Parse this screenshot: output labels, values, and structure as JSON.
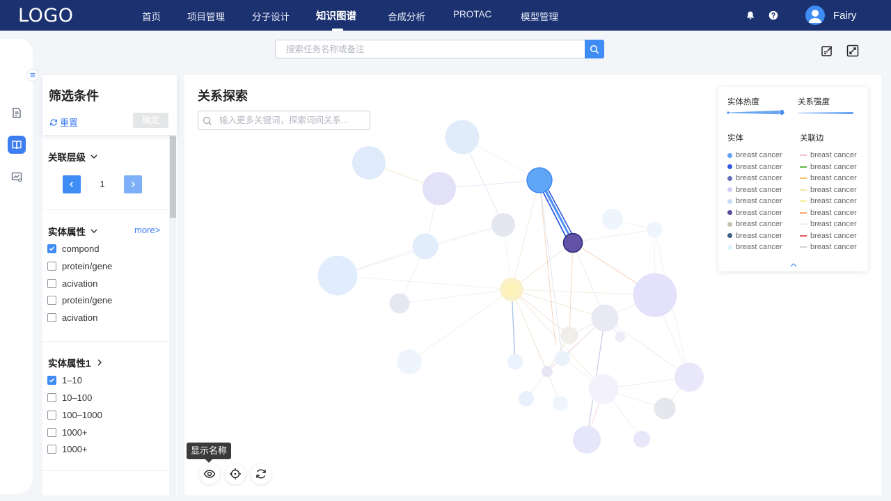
{
  "header": {
    "logo": "LOGO",
    "nav": [
      {
        "label": "首页",
        "active": false
      },
      {
        "label": "项目管理",
        "active": false
      },
      {
        "label": "分子设计",
        "active": false
      },
      {
        "label": "知识图谱",
        "active": true
      },
      {
        "label": "合成分析",
        "active": false
      },
      {
        "label": "PROTAC",
        "active": false
      },
      {
        "label": "模型管理",
        "active": false
      }
    ],
    "user_name": "Fairy"
  },
  "search": {
    "placeholder": "搜索任务名称或备注"
  },
  "filter": {
    "title": "筛选条件",
    "reset_label": "重置",
    "confirm_label": "确定",
    "level": {
      "title": "关联层级",
      "value": "1"
    },
    "entity_attr": {
      "title": "实体属性",
      "more_label": "more>",
      "options": [
        {
          "label": "compond",
          "checked": true
        },
        {
          "label": "protein/gene",
          "checked": false
        },
        {
          "label": "acivation",
          "checked": false
        },
        {
          "label": "protein/gene",
          "checked": false
        },
        {
          "label": "acivation",
          "checked": false
        }
      ]
    },
    "entity_attr1": {
      "title": "实体属性1",
      "options": [
        {
          "label": "1–10",
          "checked": true
        },
        {
          "label": "10–100",
          "checked": false
        },
        {
          "label": "100–1000",
          "checked": false
        },
        {
          "label": "1000+",
          "checked": false
        },
        {
          "label": "1000+",
          "checked": false
        }
      ]
    }
  },
  "graph": {
    "title": "关系探索",
    "keyword_placeholder": "输入更多关键词，探索词间关系...",
    "tooltip": "显示名称",
    "colors": {
      "primary": "#3f8cf5",
      "focus_node": "#5fa7f6",
      "linked_node": "#6252a8"
    }
  },
  "legend": {
    "heat_title": "实体热度",
    "strength_title": "关系强度",
    "entity_title": "实体",
    "edge_title": "关联边",
    "entities": [
      {
        "label": "breast cancer",
        "color": "#5fa3f5"
      },
      {
        "label": "breast cancer",
        "color": "#2f58e0"
      },
      {
        "label": "breast cancer",
        "color": "#6670b8"
      },
      {
        "label": "breast cancer",
        "color": "#d0cdf6"
      },
      {
        "label": "breast cancer",
        "color": "#c7dcfa"
      },
      {
        "label": "breast cancer",
        "color": "#5b4c9c"
      },
      {
        "label": "breast cancer",
        "color": "#c9c1b2"
      },
      {
        "label": "breast cancer",
        "color": "#3e5f88"
      },
      {
        "label": "breast cancer",
        "color": "#d9f3fb"
      }
    ],
    "edges": [
      {
        "label": "breast cancer",
        "color": "#f4c3c9"
      },
      {
        "label": "breast cancer",
        "color": "#62b54a"
      },
      {
        "label": "breast cancer",
        "color": "#f6c676"
      },
      {
        "label": "breast cancer",
        "color": "#eeeaa6"
      },
      {
        "label": "breast cancer",
        "color": "#f6ee9a"
      },
      {
        "label": "breast cancer",
        "color": "#f4a870"
      },
      {
        "label": "breast cancer",
        "color": "#eeeeee"
      },
      {
        "label": "breast cancer",
        "color": "#e25858"
      },
      {
        "label": "breast cancer",
        "color": "#d3d3d3"
      }
    ]
  }
}
